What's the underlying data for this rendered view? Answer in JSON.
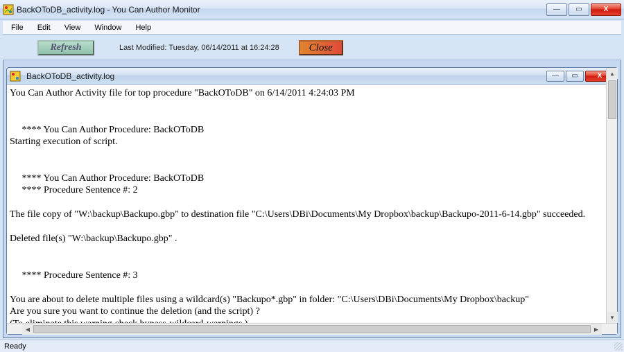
{
  "window": {
    "title": "BackOToDB_activity.log - You Can Author Monitor",
    "status": "Ready"
  },
  "menu": {
    "file": "File",
    "edit": "Edit",
    "view": "View",
    "window": "Window",
    "help": "Help"
  },
  "toolbar": {
    "refresh_label": "Refresh",
    "last_modified": "Last Modified: Tuesday, 06/14/2011 at 16:24:28",
    "close_label": "Close"
  },
  "child": {
    "title": "BackOToDB_activity.log"
  },
  "log": {
    "text": "You Can Author Activity file for top procedure \"BackOToDB\" on 6/14/2011 4:24:03 PM\n\n\n     **** You Can Author Procedure: BackOToDB\nStarting execution of script.\n\n\n     **** You Can Author Procedure: BackOToDB\n     **** Procedure Sentence #: 2\n\nThe file copy of \"W:\\backup\\Backupo.gbp\" to destination file \"C:\\Users\\DBi\\Documents\\My Dropbox\\backup\\Backupo-2011-6-14.gbp\" succeeded.\n\nDeleted file(s) \"W:\\backup\\Backupo.gbp\" .\n\n\n     **** Procedure Sentence #: 3\n\nYou are about to delete multiple files using a wildcard(s) \"Backupo*.gbp\" in folder: \"C:\\Users\\DBi\\Documents\\My Dropbox\\backup\"\nAre you sure you want to continue the deletion (and the script) ?\n(To eliminate this warning check bypass-wildcard-warnings.)"
  },
  "icons": {
    "minimize": "—",
    "maximize": "▭",
    "close": "X",
    "up": "▲",
    "down": "▼",
    "left": "◀",
    "right": "▶"
  }
}
